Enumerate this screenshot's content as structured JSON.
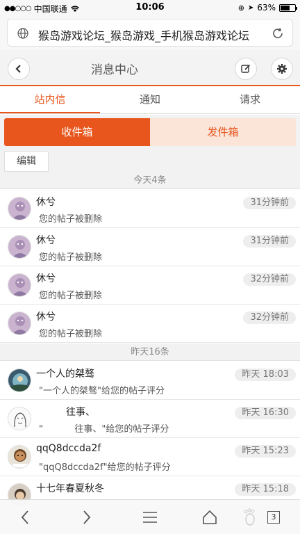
{
  "status_bar": {
    "carrier": "中国联通",
    "time": "10:06",
    "battery": "63%",
    "battery_level": 0.63
  },
  "browser": {
    "url_title": "猴岛游戏论坛_猴岛游戏_手机猴岛游戏论坛",
    "tab_count": "3"
  },
  "header": {
    "title": "消息中心"
  },
  "tabs": [
    {
      "label": "站内信",
      "active": true
    },
    {
      "label": "通知",
      "active": false
    },
    {
      "label": "请求",
      "active": false
    }
  ],
  "box_switch": {
    "inbox": "收件箱",
    "outbox": "发件箱"
  },
  "edit_label": "编辑",
  "groups": [
    {
      "header": "今天4条",
      "messages": [
        {
          "name": "休兮",
          "preview": "您的帖子被删除",
          "time": "31分钟前"
        },
        {
          "name": "休兮",
          "preview": "您的帖子被删除",
          "time": "31分钟前"
        },
        {
          "name": "休兮",
          "preview": "您的帖子被删除",
          "time": "32分钟前"
        },
        {
          "name": "休兮",
          "preview": "您的帖子被删除",
          "time": "32分钟前"
        }
      ]
    },
    {
      "header": "昨天16条",
      "messages": [
        {
          "name": "一个人的桀骜",
          "preview": "\"一个人的桀骜\"给您的帖子评分",
          "time": "昨天 18:03"
        },
        {
          "name": "往事、",
          "preview": "\"           往事、\"给您的帖子评分",
          "time": "昨天 16:30"
        },
        {
          "name": "qqQ8dccda2f",
          "preview": "\"qqQ8dccda2f\"给您的帖子评分",
          "time": "昨天 15:23"
        },
        {
          "name": "十七年春夏秋冬",
          "preview": "",
          "time": "昨天 15:18"
        }
      ]
    }
  ],
  "colors": {
    "accent": "#e8561d",
    "accent_light": "#fbe4d8"
  }
}
